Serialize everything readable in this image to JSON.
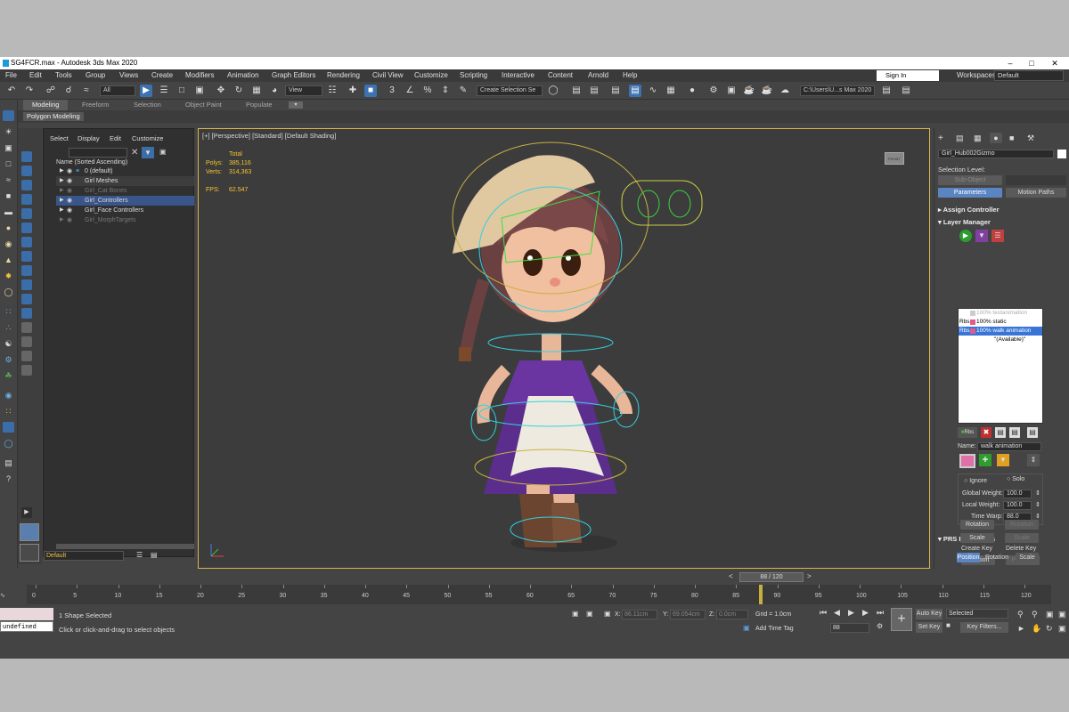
{
  "window": {
    "title": "SG4FCR.max - Autodesk 3ds Max 2020"
  },
  "menu": [
    "File",
    "Edit",
    "Tools",
    "Group",
    "Views",
    "Create",
    "Modifiers",
    "Animation",
    "Graph Editors",
    "Rendering",
    "Civil View",
    "Customize",
    "Scripting",
    "Interactive",
    "Content",
    "Arnold",
    "Help"
  ],
  "signin": "Sign In",
  "workspaces": {
    "label": "Workspaces:",
    "value": "Default"
  },
  "toolbar": {
    "filter": "All",
    "view": "View",
    "selection_set": "Create Selection Se",
    "path": "C:\\Users\\U...s Max 2020"
  },
  "ribbon": {
    "tabs": [
      "Modeling",
      "Freeform",
      "Selection",
      "Object Paint",
      "Populate"
    ],
    "active": "Polygon Modeling"
  },
  "scene_explorer": {
    "menus": [
      "Select",
      "Display",
      "Edit",
      "Customize"
    ],
    "header": "Name (Sorted Ascending)",
    "rows": [
      "0 (default)",
      "Girl Meshes",
      "Girl_Cat Bones",
      "Girl_Controllers",
      "Girl_Face Controllers",
      "Girl_MorphTargets"
    ],
    "layer": "Default"
  },
  "viewport": {
    "label": "[+] [Perspective] [Standard] [Default Shading]",
    "stats": {
      "total": "Total",
      "polys_label": "Polys:",
      "polys": "385,116",
      "verts_label": "Verts:",
      "verts": "314,363",
      "fps_label": "FPS:",
      "fps": "62.547"
    },
    "viewcube": "FRONT"
  },
  "command_panel": {
    "object_name": "Girl_Hub002Gizmo",
    "selection_level": "Selection Level:",
    "sub_object": "Sub-Object",
    "tab_parameters": "Parameters",
    "tab_motion_paths": "Motion Paths",
    "assign_controller": "Assign Controller",
    "layer_manager": "Layer Manager",
    "layers": [
      {
        "prefix": "",
        "name": "100% testanimation",
        "state": "dim"
      },
      {
        "prefix": "Rbs",
        "name": "100% static",
        "state": "normal"
      },
      {
        "prefix": "Rbs",
        "name": "100% walk animation",
        "state": "sel"
      },
      {
        "prefix": "",
        "name": "\"(Available)\"",
        "state": "normal"
      }
    ],
    "name_label": "Name:",
    "name_value": "walk animation",
    "ignore": "Ignore",
    "solo": "Solo",
    "global_weight_label": "Global Weight:",
    "global_weight": "100.0",
    "local_weight_label": "Local Weight:",
    "local_weight": "100.0",
    "time_warp_label": "Time Warp:",
    "time_warp": "88.0",
    "prs": "PRS Parameters",
    "create_key": "Create Key",
    "delete_key": "Delete Key",
    "position": "Position",
    "rotation": "Rotation",
    "scale": "Scale",
    "prs_tabs": [
      "Position",
      "Rotation",
      "Scale"
    ],
    "rbs_btn": "Rbs"
  },
  "timeline": {
    "frame": "88 / 120",
    "ticks": [
      "0",
      "5",
      "10",
      "15",
      "20",
      "25",
      "30",
      "35",
      "40",
      "45",
      "50",
      "55",
      "60",
      "65",
      "70",
      "75",
      "80",
      "85",
      "90",
      "95",
      "100",
      "105",
      "110",
      "115",
      "120"
    ],
    "current_frame": 88,
    "max_frame": 120
  },
  "status": {
    "selected": "1 Shape Selected",
    "prompt": "Click or click-and-drag to select objects",
    "listener": "undefined",
    "x_label": "X:",
    "x": "86.11cm",
    "y_label": "Y:",
    "y": "69.054cm",
    "z_label": "Z:",
    "z": "0.0cm",
    "grid": "Grid = 1.0cm",
    "add_time_tag": "Add Time Tag",
    "auto_key": "Auto Key",
    "set_key": "Set Key",
    "selected_drop": "Selected",
    "key_filters": "Key Filters...",
    "frame_field": "88"
  }
}
